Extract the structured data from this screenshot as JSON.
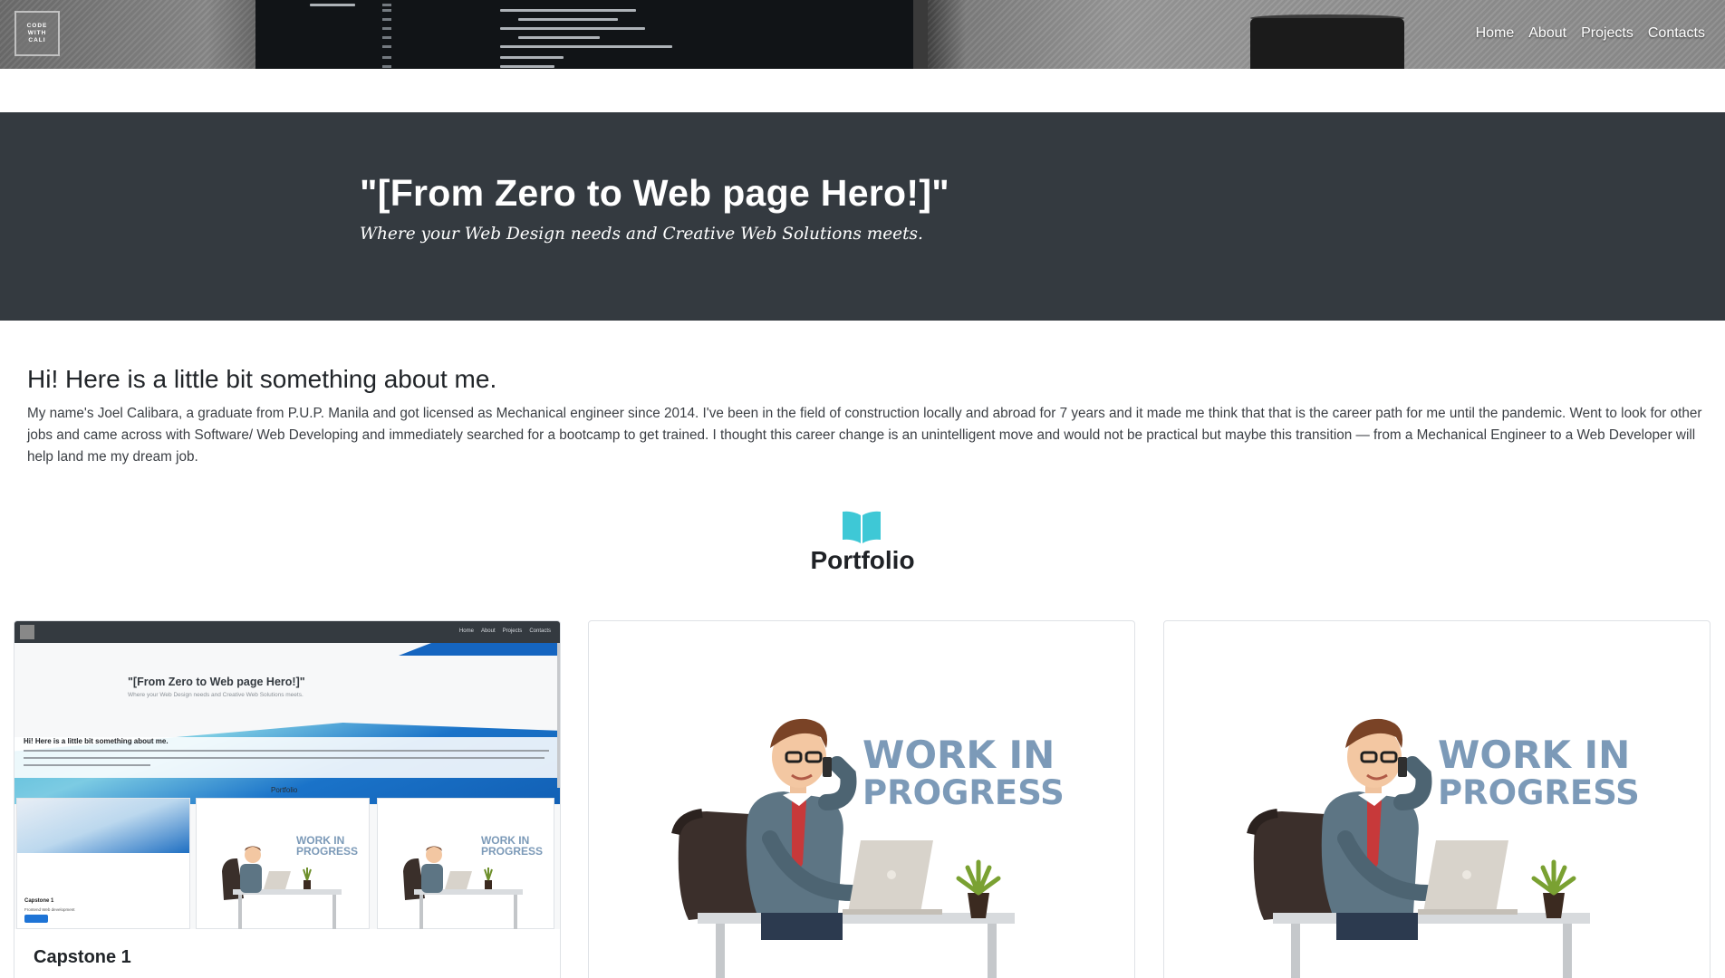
{
  "navbar": {
    "brand_lines": [
      "CODE",
      "WITH",
      "CALI"
    ],
    "links": [
      "Home",
      "About",
      "Projects",
      "Contacts"
    ]
  },
  "hero": {
    "title": "\"[From Zero to Web page Hero!]\"",
    "subtitle": "Where your Web Design needs and Creative Web Solutions meets."
  },
  "about": {
    "heading": "Hi! Here is a little bit something about me.",
    "body": "My name's Joel Calibara, a graduate from P.U.P. Manila and got licensed as Mechanical engineer since 2014. I've been in the field of construction locally and abroad for 7 years and it made me think that that is the career path for me until the pandemic. Went to look for other jobs and came across with Software/ Web Developing and immediately searched for a bootcamp to get trained. I thought this career change is an unintelligent move and would not be practical but maybe this transition — from a Mechanical Engineer to a Web Developer will help land me my dream job."
  },
  "portfolio": {
    "icon": "book-open-icon",
    "icon_color": "#3ec8d6",
    "title": "Portfolio",
    "cards": [
      {
        "title": "Capstone 1",
        "preview": {
          "nav_links": [
            "Home",
            "About",
            "Projects",
            "Contacts"
          ],
          "title": "\"[From Zero to Web page Hero!]\"",
          "subtitle": "Where your Web Design needs and Creative Web Solutions meets.",
          "heading": "Hi! Here is a little bit something about me.",
          "section": "Portfolio",
          "card_label": "Capstone 1",
          "card_desc": "Frontend Web development",
          "wip_line1": "WORK IN",
          "wip_line2": "PROGRESS"
        }
      },
      {
        "wip_line1": "WORK IN",
        "wip_line2": "PROGRESS"
      },
      {
        "wip_line1": "WORK IN",
        "wip_line2": "PROGRESS"
      }
    ]
  },
  "colors": {
    "hero_bg": "#343a40",
    "wip_text": "#7c9ab8"
  }
}
